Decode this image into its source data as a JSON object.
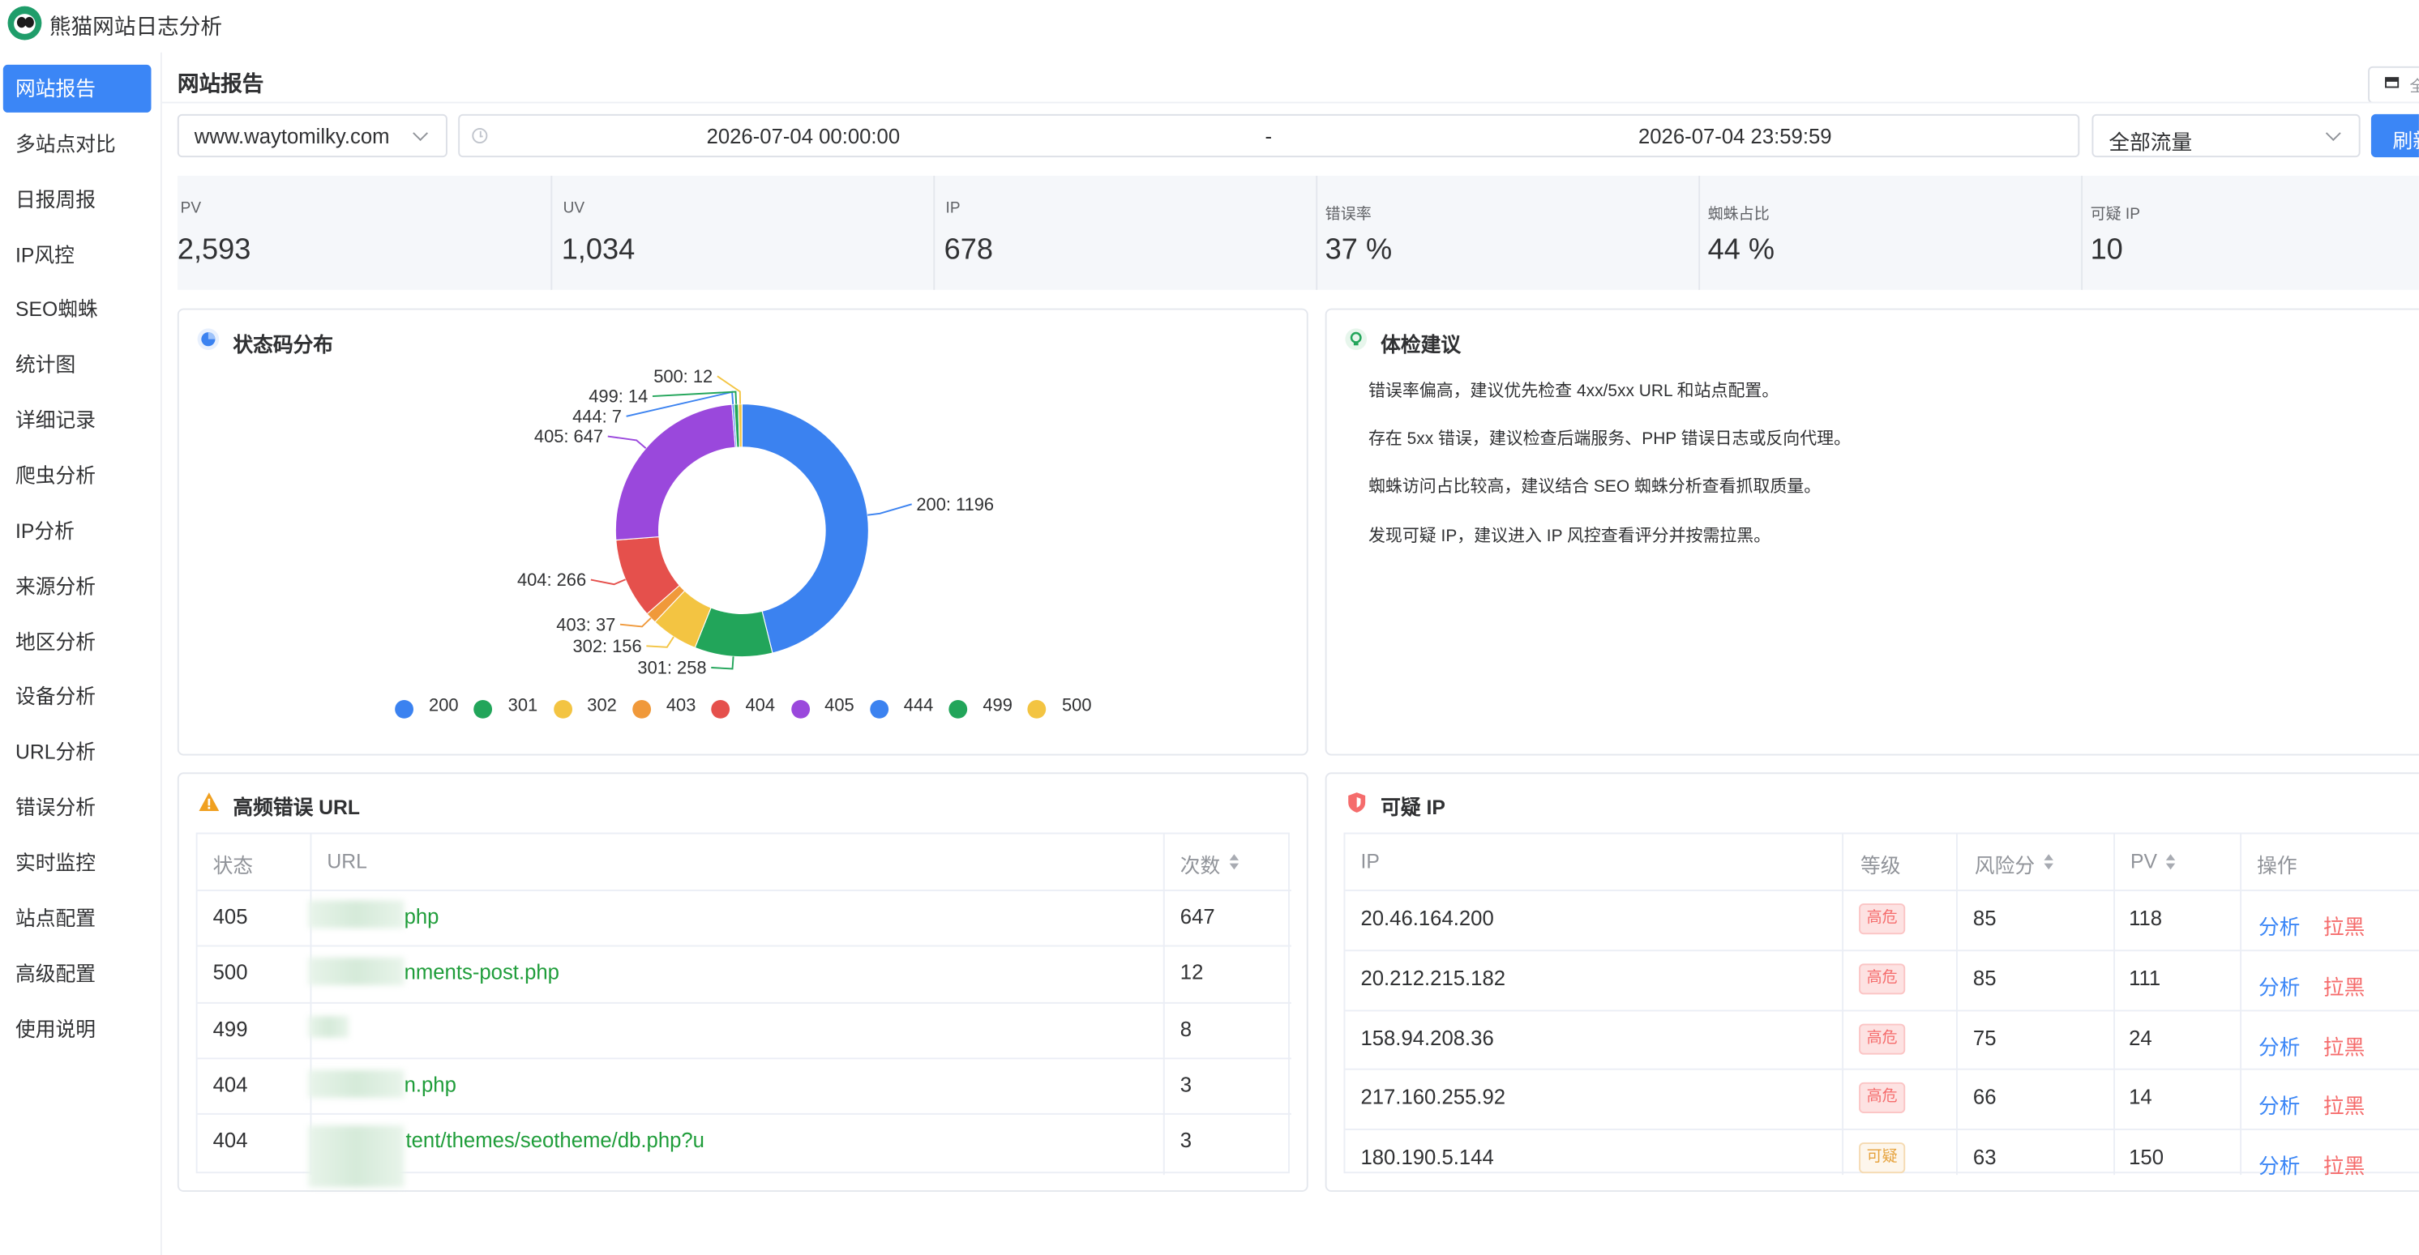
{
  "app": {
    "title": "熊猫网站日志分析"
  },
  "sidebar": {
    "items": [
      {
        "label": "网站报告",
        "active": true
      },
      {
        "label": "多站点对比"
      },
      {
        "label": "日报周报"
      },
      {
        "label": "IP风控"
      },
      {
        "label": "SEO蜘蛛"
      },
      {
        "label": "统计图"
      },
      {
        "label": "详细记录"
      },
      {
        "label": "爬虫分析"
      },
      {
        "label": "IP分析"
      },
      {
        "label": "来源分析"
      },
      {
        "label": "地区分析"
      },
      {
        "label": "设备分析"
      },
      {
        "label": "URL分析"
      },
      {
        "label": "错误分析"
      },
      {
        "label": "实时监控"
      },
      {
        "label": "站点配置"
      },
      {
        "label": "高级配置"
      },
      {
        "label": "使用说明"
      }
    ]
  },
  "header": {
    "page_title": "网站报告",
    "fullscreen_label": "全"
  },
  "filters": {
    "site": "www.waytomilky.com",
    "range_start": "2026-07-04 00:00:00",
    "range_sep": "-",
    "range_end": "2026-07-04 23:59:59",
    "traffic": "全部流量",
    "refresh_label": "刷新"
  },
  "stats": [
    {
      "label": "PV",
      "value": "2,593"
    },
    {
      "label": "UV",
      "value": "1,034"
    },
    {
      "label": "IP",
      "value": "678"
    },
    {
      "label": "错误率",
      "value": "37 %"
    },
    {
      "label": "蜘蛛占比",
      "value": "44 %"
    },
    {
      "label": "可疑 IP",
      "value": "10"
    }
  ],
  "status_card": {
    "title": "状态码分布"
  },
  "chart_data": {
    "type": "pie",
    "donut": true,
    "categories": [
      "200",
      "301",
      "302",
      "403",
      "404",
      "405",
      "444",
      "499",
      "500"
    ],
    "values": [
      1196,
      258,
      156,
      37,
      266,
      647,
      7,
      14,
      12
    ],
    "colors": [
      "#3b82f0",
      "#22a55a",
      "#f3c442",
      "#f0993a",
      "#e5504c",
      "#9a48dc",
      "#3b82f0",
      "#22a55a",
      "#f3c442"
    ],
    "data_labels": [
      "200: 1196",
      "301: 258",
      "302: 156",
      "403: 37",
      "404: 266",
      "405: 647",
      "444: 7",
      "499: 14",
      "500: 12"
    ],
    "legend": "bottom"
  },
  "advice_card": {
    "title": "体检建议",
    "items": [
      "错误率偏高，建议优先检查 4xx/5xx URL 和站点配置。",
      "存在 5xx 错误，建议检查后端服务、PHP 错误日志或反向代理。",
      "蜘蛛访问占比较高，建议结合 SEO 蜘蛛分析查看抓取质量。",
      "发现可疑 IP，建议进入 IP 风控查看评分并按需拉黑。"
    ]
  },
  "error_urls": {
    "title": "高频错误 URL",
    "columns": [
      "状态",
      "URL",
      "次数"
    ],
    "rows": [
      {
        "status": "405",
        "url": "php",
        "count": "647"
      },
      {
        "status": "500",
        "url": "nments-post.php",
        "count": "12"
      },
      {
        "status": "499",
        "url": "",
        "count": "8"
      },
      {
        "status": "404",
        "url": "n.php",
        "count": "3"
      },
      {
        "status": "404",
        "url": "tent/themes/seotheme/db.php?u",
        "count": "3"
      }
    ]
  },
  "suspicious_ip": {
    "title": "可疑 IP",
    "columns": [
      "IP",
      "等级",
      "风险分",
      "PV",
      "操作"
    ],
    "rows": [
      {
        "ip": "20.46.164.200",
        "level": "高危",
        "score": "85",
        "pv": "118"
      },
      {
        "ip": "20.212.215.182",
        "level": "高危",
        "score": "85",
        "pv": "111"
      },
      {
        "ip": "158.94.208.36",
        "level": "高危",
        "score": "75",
        "pv": "24"
      },
      {
        "ip": "217.160.255.92",
        "level": "高危",
        "score": "66",
        "pv": "14"
      },
      {
        "ip": "180.190.5.144",
        "level": "可疑",
        "score": "63",
        "pv": "150"
      }
    ],
    "action_analyze": "分析",
    "action_block": "拉黑"
  }
}
